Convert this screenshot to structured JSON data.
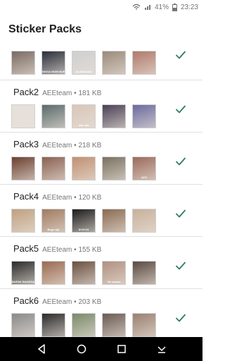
{
  "status_bar": {
    "battery": "41%",
    "time": "23:23"
  },
  "app_bar": {
    "title": "Sticker Packs"
  },
  "colors": {
    "accent": "#2e7d5b",
    "divider": "#e0e0e0",
    "nav_bar": "#000000"
  },
  "packs": [
    {
      "name": "",
      "publisher": "",
      "size": "",
      "thumbnails": [
        {
          "caption": "",
          "color": "#7a6a60"
        },
        {
          "caption": "NGGA NGIN BURY",
          "color": "#2a2f3a"
        },
        {
          "caption": "ALAMAAAK",
          "color": "#cfcfcf"
        },
        {
          "caption": "",
          "color": "#9a8a7a"
        },
        {
          "caption": "",
          "color": "#b07a6a"
        }
      ]
    },
    {
      "name": "Pack2",
      "publisher": "AEEteam",
      "size": "181 KB",
      "thumbnails": [
        {
          "caption": "",
          "color": "#e6e0da"
        },
        {
          "caption": "",
          "color": "#5a6a6a"
        },
        {
          "caption": "Jam otu",
          "color": "#d8c6b8"
        },
        {
          "caption": "",
          "color": "#4a3f55"
        },
        {
          "caption": "",
          "color": "#6a6aa0"
        }
      ]
    },
    {
      "name": "Pack3",
      "publisher": "AEEteam",
      "size": "218 KB",
      "thumbnails": [
        {
          "caption": "",
          "color": "#6a4030"
        },
        {
          "caption": "",
          "color": "#8a6050"
        },
        {
          "caption": "",
          "color": "#c09070"
        },
        {
          "caption": "",
          "color": "#7a7060"
        },
        {
          "caption": "AYO",
          "color": "#9a6a5a"
        }
      ]
    },
    {
      "name": "Pack4",
      "publisher": "AEEteam",
      "size": "120 KB",
      "thumbnails": [
        {
          "caption": "",
          "color": "#c0a080"
        },
        {
          "caption": "Bego ajir",
          "color": "#a07a60"
        },
        {
          "caption": "IH IH IH",
          "color": "#1a1a1a"
        },
        {
          "caption": "",
          "color": "#8a6a50"
        },
        {
          "caption": "",
          "color": "#c8b09a"
        }
      ]
    },
    {
      "name": "Pack5",
      "publisher": "AEEteam",
      "size": "155 KB",
      "thumbnails": [
        {
          "caption": "BAPAK BANGSA",
          "color": "#2a2a2a"
        },
        {
          "caption": "",
          "color": "#9a6a50"
        },
        {
          "caption": "",
          "color": "#6a5040"
        },
        {
          "caption": "YA ampun",
          "color": "#b09080"
        },
        {
          "caption": "",
          "color": "#5a4a40"
        }
      ]
    },
    {
      "name": "Pack6",
      "publisher": "AEEteam",
      "size": "203 KB",
      "thumbnails": [
        {
          "caption": "",
          "color": "#8a8a8a"
        },
        {
          "caption": "",
          "color": "#2a2a2a"
        },
        {
          "caption": "",
          "color": "#7a8a6a"
        },
        {
          "caption": "",
          "color": "#6a5a50"
        },
        {
          "caption": "",
          "color": "#9a8070"
        }
      ]
    }
  ],
  "nav_bar": {
    "buttons": [
      "back-icon",
      "home-icon",
      "recents-icon",
      "keyboard-hide-icon"
    ]
  }
}
